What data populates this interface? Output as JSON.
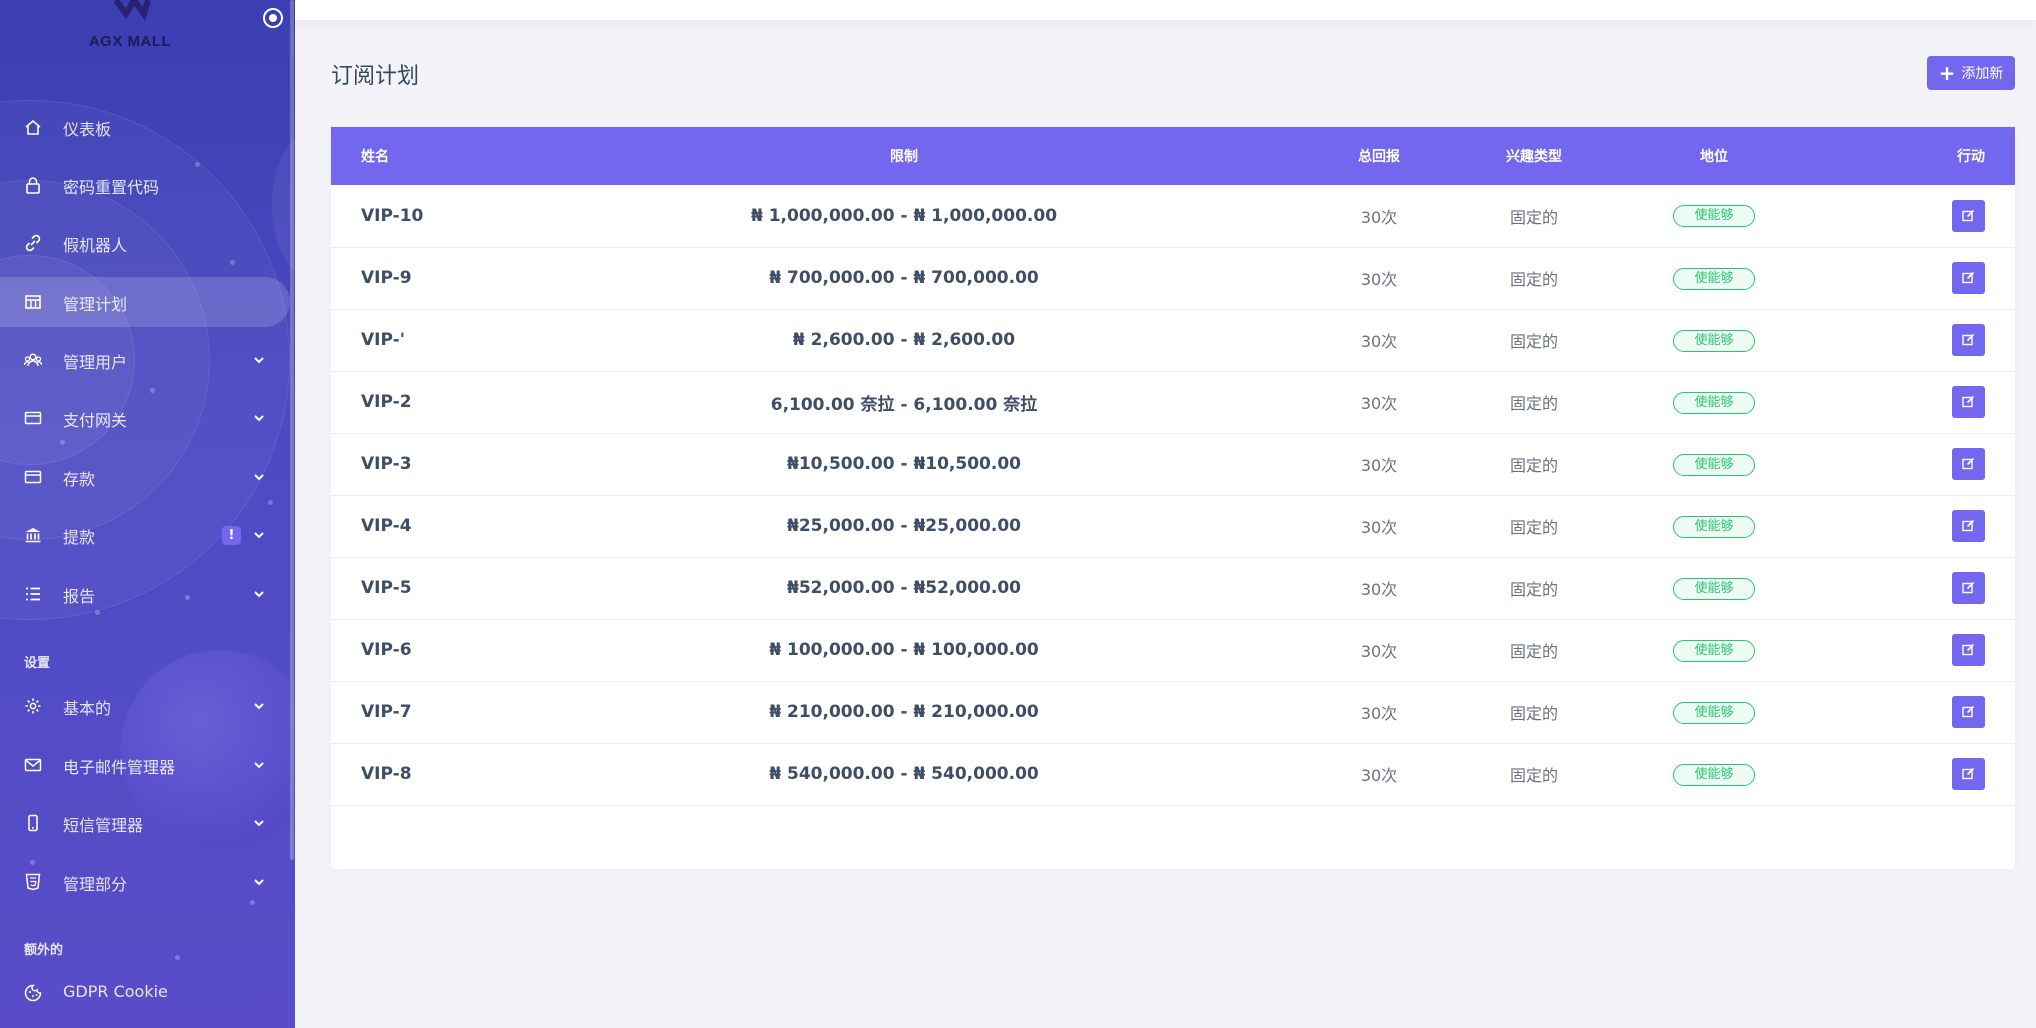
{
  "brand": {
    "name": "AGX MALL"
  },
  "sidebar": {
    "items": [
      {
        "label": "仪表板",
        "icon": "home-icon",
        "has_chevron": false
      },
      {
        "label": "密码重置代码",
        "icon": "lock-icon",
        "has_chevron": false
      },
      {
        "label": "假机器人",
        "icon": "link-icon",
        "has_chevron": false
      },
      {
        "label": "管理计划",
        "icon": "plan-icon",
        "has_chevron": false,
        "active": true
      },
      {
        "label": "管理用户",
        "icon": "users-icon",
        "has_chevron": true
      },
      {
        "label": "支付网关",
        "icon": "credit-card-icon",
        "has_chevron": true
      },
      {
        "label": "存款",
        "icon": "wallet-icon",
        "has_chevron": true
      },
      {
        "label": "提款",
        "icon": "bank-icon",
        "has_chevron": true,
        "badge": "!"
      },
      {
        "label": "报告",
        "icon": "list-icon",
        "has_chevron": true
      }
    ],
    "section_settings": "设置",
    "settings_items": [
      {
        "label": "基本的",
        "icon": "gear-icon",
        "has_chevron": true
      },
      {
        "label": "电子邮件管理器",
        "icon": "mail-icon",
        "has_chevron": true
      },
      {
        "label": "短信管理器",
        "icon": "mobile-icon",
        "has_chevron": true
      },
      {
        "label": "管理部分",
        "icon": "html5-icon",
        "has_chevron": true
      }
    ],
    "section_extra": "额外的",
    "extra_items": [
      {
        "label": "GDPR Cookie",
        "icon": "cookie-icon",
        "has_chevron": false
      }
    ]
  },
  "page": {
    "title": "订阅计划",
    "add_button": "添加新"
  },
  "table": {
    "headers": {
      "name": "姓名",
      "limit": "限制",
      "return": "总回报",
      "interest_type": "兴趣类型",
      "status": "地位",
      "action": "行动"
    },
    "rows": [
      {
        "name": "VIP-10",
        "limit": "₦ 1,000,000.00 - ₦ 1,000,000.00",
        "return": "30次",
        "interest_type": "固定的",
        "status": "使能够"
      },
      {
        "name": "VIP-9",
        "limit": "₦ 700,000.00 - ₦ 700,000.00",
        "return": "30次",
        "interest_type": "固定的",
        "status": "使能够"
      },
      {
        "name": "VIP-'",
        "limit": "₦ 2,600.00 - ₦ 2,600.00",
        "return": "30次",
        "interest_type": "固定的",
        "status": "使能够"
      },
      {
        "name": "VIP-2",
        "limit": "6,100.00 奈拉 - 6,100.00 奈拉",
        "return": "30次",
        "interest_type": "固定的",
        "status": "使能够"
      },
      {
        "name": "VIP-3",
        "limit": "₦10,500.00 - ₦10,500.00",
        "return": "30次",
        "interest_type": "固定的",
        "status": "使能够"
      },
      {
        "name": "VIP-4",
        "limit": "₦25,000.00 - ₦25,000.00",
        "return": "30次",
        "interest_type": "固定的",
        "status": "使能够"
      },
      {
        "name": "VIP-5",
        "limit": "₦52,000.00 - ₦52,000.00",
        "return": "30次",
        "interest_type": "固定的",
        "status": "使能够"
      },
      {
        "name": "VIP-6",
        "limit": "₦ 100,000.00 - ₦ 100,000.00",
        "return": "30次",
        "interest_type": "固定的",
        "status": "使能够"
      },
      {
        "name": "VIP-7",
        "limit": "₦ 210,000.00 - ₦ 210,000.00",
        "return": "30次",
        "interest_type": "固定的",
        "status": "使能够"
      },
      {
        "name": "VIP-8",
        "limit": "₦ 540,000.00 - ₦ 540,000.00",
        "return": "30次",
        "interest_type": "固定的",
        "status": "使能够"
      }
    ]
  },
  "colors": {
    "accent": "#7367f0",
    "sidebar_top": "#3b3fb3",
    "status_green": "#28c76f"
  }
}
